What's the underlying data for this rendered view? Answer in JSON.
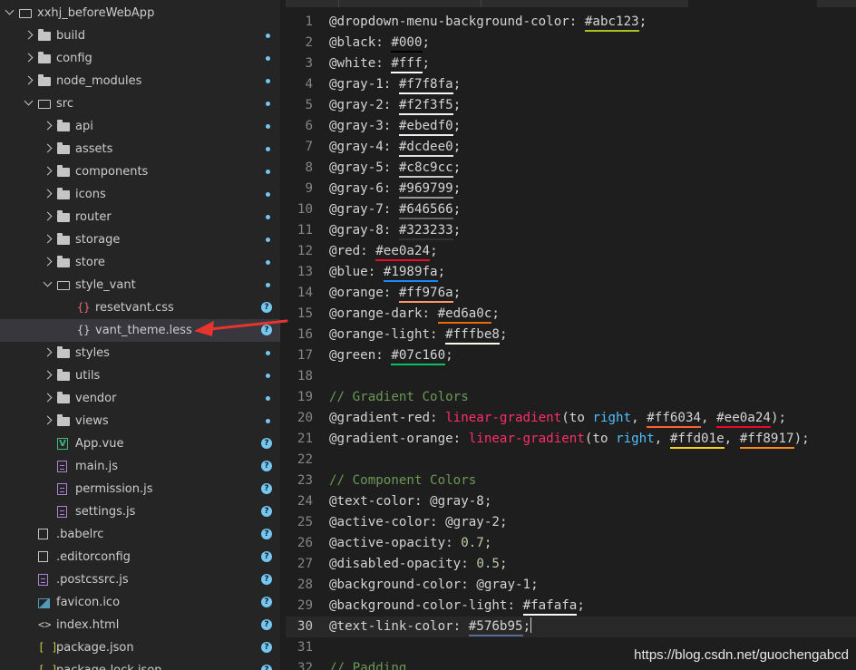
{
  "explorer": {
    "items": [
      {
        "depth": 0,
        "type": "folder-open",
        "label": "xxhj_beforeWebApp",
        "status": "",
        "expanded": true
      },
      {
        "depth": 1,
        "type": "folder",
        "label": "build",
        "status": "dot"
      },
      {
        "depth": 1,
        "type": "folder",
        "label": "config",
        "status": "dot"
      },
      {
        "depth": 1,
        "type": "folder",
        "label": "node_modules",
        "status": "dot"
      },
      {
        "depth": 1,
        "type": "folder-open",
        "label": "src",
        "status": "dot",
        "expanded": true
      },
      {
        "depth": 2,
        "type": "folder",
        "label": "api",
        "status": "dot"
      },
      {
        "depth": 2,
        "type": "folder",
        "label": "assets",
        "status": "dot"
      },
      {
        "depth": 2,
        "type": "folder",
        "label": "components",
        "status": "dot"
      },
      {
        "depth": 2,
        "type": "folder",
        "label": "icons",
        "status": "dot"
      },
      {
        "depth": 2,
        "type": "folder",
        "label": "router",
        "status": "dot"
      },
      {
        "depth": 2,
        "type": "folder",
        "label": "storage",
        "status": "dot"
      },
      {
        "depth": 2,
        "type": "folder",
        "label": "store",
        "status": "dot"
      },
      {
        "depth": 2,
        "type": "folder-open",
        "label": "style_vant",
        "status": "dot",
        "expanded": true
      },
      {
        "depth": 3,
        "type": "css",
        "label": "resetvant.css",
        "status": "badge"
      },
      {
        "depth": 3,
        "type": "less",
        "label": "vant_theme.less",
        "status": "badge",
        "selected": true
      },
      {
        "depth": 2,
        "type": "folder",
        "label": "styles",
        "status": "dot"
      },
      {
        "depth": 2,
        "type": "folder",
        "label": "utils",
        "status": "dot"
      },
      {
        "depth": 2,
        "type": "folder",
        "label": "vendor",
        "status": "dot"
      },
      {
        "depth": 2,
        "type": "folder",
        "label": "views",
        "status": "dot"
      },
      {
        "depth": 2,
        "type": "vue",
        "label": "App.vue",
        "status": "badge"
      },
      {
        "depth": 2,
        "type": "js",
        "label": "main.js",
        "status": "badge"
      },
      {
        "depth": 2,
        "type": "js",
        "label": "permission.js",
        "status": "badge"
      },
      {
        "depth": 2,
        "type": "js",
        "label": "settings.js",
        "status": "badge"
      },
      {
        "depth": 1,
        "type": "file",
        "label": ".babelrc",
        "status": "badge"
      },
      {
        "depth": 1,
        "type": "file",
        "label": ".editorconfig",
        "status": "badge"
      },
      {
        "depth": 1,
        "type": "js",
        "label": ".postcssrc.js",
        "status": "badge"
      },
      {
        "depth": 1,
        "type": "image",
        "label": "favicon.ico",
        "status": "badge"
      },
      {
        "depth": 1,
        "type": "html",
        "label": "index.html",
        "status": "badge"
      },
      {
        "depth": 1,
        "type": "json",
        "label": "package.json",
        "status": "badge"
      },
      {
        "depth": 1,
        "type": "json",
        "label": "package-lock.json",
        "status": "badge"
      }
    ],
    "badge_text": "?",
    "colors": {
      "accent": "#73c7f2",
      "selected_bg": "#37373d",
      "sidebar_bg": "#252526"
    }
  },
  "editor": {
    "filename": "vant_theme.less",
    "current_line": 30,
    "lines": [
      {
        "n": "1",
        "tokens": [
          [
            "var",
            "@dropdown-menu-background-color"
          ],
          [
            "punc",
            ": "
          ],
          [
            "col",
            "#abc123",
            "#abc123"
          ],
          [
            "punc",
            ";"
          ]
        ]
      },
      {
        "n": "2",
        "tokens": [
          [
            "var",
            "@black"
          ],
          [
            "punc",
            ": "
          ],
          [
            "col",
            "#000",
            "#000000"
          ],
          [
            "punc",
            ";"
          ]
        ]
      },
      {
        "n": "3",
        "tokens": [
          [
            "var",
            "@white"
          ],
          [
            "punc",
            ": "
          ],
          [
            "col",
            "#fff",
            "#ffffff"
          ],
          [
            "punc",
            ";"
          ]
        ]
      },
      {
        "n": "4",
        "tokens": [
          [
            "var",
            "@gray-1"
          ],
          [
            "punc",
            ": "
          ],
          [
            "col",
            "#f7f8fa",
            "#f7f8fa"
          ],
          [
            "punc",
            ";"
          ]
        ]
      },
      {
        "n": "5",
        "tokens": [
          [
            "var",
            "@gray-2"
          ],
          [
            "punc",
            ": "
          ],
          [
            "col",
            "#f2f3f5",
            "#f2f3f5"
          ],
          [
            "punc",
            ";"
          ]
        ]
      },
      {
        "n": "6",
        "tokens": [
          [
            "var",
            "@gray-3"
          ],
          [
            "punc",
            ": "
          ],
          [
            "col",
            "#ebedf0",
            "#ebedf0"
          ],
          [
            "punc",
            ";"
          ]
        ]
      },
      {
        "n": "7",
        "tokens": [
          [
            "var",
            "@gray-4"
          ],
          [
            "punc",
            ": "
          ],
          [
            "col",
            "#dcdee0",
            "#dcdee0"
          ],
          [
            "punc",
            ";"
          ]
        ]
      },
      {
        "n": "8",
        "tokens": [
          [
            "var",
            "@gray-5"
          ],
          [
            "punc",
            ": "
          ],
          [
            "col",
            "#c8c9cc",
            "#c8c9cc"
          ],
          [
            "punc",
            ";"
          ]
        ]
      },
      {
        "n": "9",
        "tokens": [
          [
            "var",
            "@gray-6"
          ],
          [
            "punc",
            ": "
          ],
          [
            "col",
            "#969799",
            "#969799"
          ],
          [
            "punc",
            ";"
          ]
        ]
      },
      {
        "n": "10",
        "tokens": [
          [
            "var",
            "@gray-7"
          ],
          [
            "punc",
            ": "
          ],
          [
            "col",
            "#646566",
            "#646566"
          ],
          [
            "punc",
            ";"
          ]
        ]
      },
      {
        "n": "11",
        "tokens": [
          [
            "var",
            "@gray-8"
          ],
          [
            "punc",
            ": "
          ],
          [
            "col",
            "#323233",
            "#323233"
          ],
          [
            "punc",
            ";"
          ]
        ]
      },
      {
        "n": "12",
        "tokens": [
          [
            "var",
            "@red"
          ],
          [
            "punc",
            ": "
          ],
          [
            "col",
            "#ee0a24",
            "#ee0a24"
          ],
          [
            "punc",
            ";"
          ]
        ]
      },
      {
        "n": "13",
        "tokens": [
          [
            "var",
            "@blue"
          ],
          [
            "punc",
            ": "
          ],
          [
            "col",
            "#1989fa",
            "#1989fa"
          ],
          [
            "punc",
            ";"
          ]
        ]
      },
      {
        "n": "14",
        "tokens": [
          [
            "var",
            "@orange"
          ],
          [
            "punc",
            ": "
          ],
          [
            "col",
            "#ff976a",
            "#ff976a"
          ],
          [
            "punc",
            ";"
          ]
        ]
      },
      {
        "n": "15",
        "tokens": [
          [
            "var",
            "@orange-dark"
          ],
          [
            "punc",
            ": "
          ],
          [
            "col",
            "#ed6a0c",
            "#ed6a0c"
          ],
          [
            "punc",
            ";"
          ]
        ]
      },
      {
        "n": "16",
        "tokens": [
          [
            "var",
            "@orange-light"
          ],
          [
            "punc",
            ": "
          ],
          [
            "col",
            "#fffbe8",
            "#fffbe8"
          ],
          [
            "punc",
            ";"
          ]
        ]
      },
      {
        "n": "17",
        "tokens": [
          [
            "var",
            "@green"
          ],
          [
            "punc",
            ": "
          ],
          [
            "col",
            "#07c160",
            "#07c160"
          ],
          [
            "punc",
            ";"
          ]
        ]
      },
      {
        "n": "18",
        "tokens": []
      },
      {
        "n": "19",
        "tokens": [
          [
            "comment",
            "// Gradient Colors"
          ]
        ]
      },
      {
        "n": "20",
        "tokens": [
          [
            "var",
            "@gradient-red"
          ],
          [
            "punc",
            ": "
          ],
          [
            "fn2",
            "linear-gradient"
          ],
          [
            "punc",
            "(to "
          ],
          [
            "kw",
            "right"
          ],
          [
            "punc",
            ", "
          ],
          [
            "col",
            "#ff6034",
            "#ff6034"
          ],
          [
            "punc",
            ", "
          ],
          [
            "col",
            "#ee0a24",
            "#ee0a24"
          ],
          [
            "punc",
            ");"
          ]
        ]
      },
      {
        "n": "21",
        "tokens": [
          [
            "var",
            "@gradient-orange"
          ],
          [
            "punc",
            ": "
          ],
          [
            "fn2",
            "linear-gradient"
          ],
          [
            "punc",
            "(to "
          ],
          [
            "kw",
            "right"
          ],
          [
            "punc",
            ", "
          ],
          [
            "col",
            "#ffd01e",
            "#ffd01e"
          ],
          [
            "punc",
            ", "
          ],
          [
            "col",
            "#ff8917",
            "#ff8917"
          ],
          [
            "punc",
            ");"
          ]
        ]
      },
      {
        "n": "22",
        "tokens": []
      },
      {
        "n": "23",
        "tokens": [
          [
            "comment",
            "// Component Colors"
          ]
        ]
      },
      {
        "n": "24",
        "tokens": [
          [
            "var",
            "@text-color"
          ],
          [
            "punc",
            ": "
          ],
          [
            "var",
            "@gray-8"
          ],
          [
            "punc",
            ";"
          ]
        ]
      },
      {
        "n": "25",
        "tokens": [
          [
            "var",
            "@active-color"
          ],
          [
            "punc",
            ": "
          ],
          [
            "var",
            "@gray-2"
          ],
          [
            "punc",
            ";"
          ]
        ]
      },
      {
        "n": "26",
        "tokens": [
          [
            "var",
            "@active-opacity"
          ],
          [
            "punc",
            ": "
          ],
          [
            "num",
            "0.7"
          ],
          [
            "punc",
            ";"
          ]
        ]
      },
      {
        "n": "27",
        "tokens": [
          [
            "var",
            "@disabled-opacity"
          ],
          [
            "punc",
            ": "
          ],
          [
            "num",
            "0.5"
          ],
          [
            "punc",
            ";"
          ]
        ]
      },
      {
        "n": "28",
        "tokens": [
          [
            "var",
            "@background-color"
          ],
          [
            "punc",
            ": "
          ],
          [
            "var",
            "@gray-1"
          ],
          [
            "punc",
            ";"
          ]
        ]
      },
      {
        "n": "29",
        "tokens": [
          [
            "var",
            "@background-color-light"
          ],
          [
            "punc",
            ": "
          ],
          [
            "col",
            "#fafafa",
            "#fafafa"
          ],
          [
            "punc",
            ";"
          ]
        ]
      },
      {
        "n": "30",
        "tokens": [
          [
            "var",
            "@text-link-color"
          ],
          [
            "punc",
            ": "
          ],
          [
            "col",
            "#576b95",
            "#576b95"
          ],
          [
            "punc",
            ";"
          ],
          [
            "cursor",
            ""
          ]
        ]
      },
      {
        "n": "31",
        "tokens": []
      },
      {
        "n": "32",
        "tokens": [
          [
            "comment",
            "// Padding"
          ]
        ]
      }
    ]
  },
  "annotation": {
    "arrow_color": "#e8342f"
  },
  "watermark": "https://blog.csdn.net/guochengabcd"
}
